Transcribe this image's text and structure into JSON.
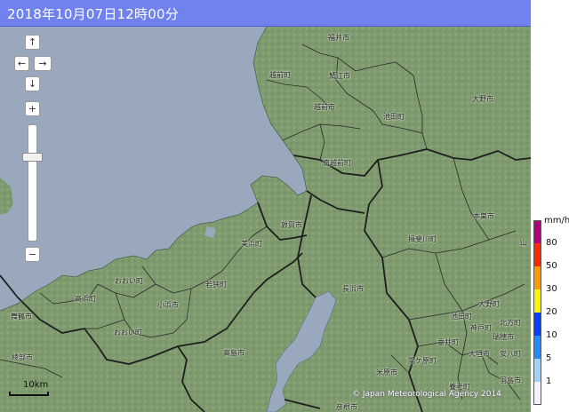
{
  "header": {
    "timestamp": "2018年10月07日12時00分"
  },
  "controls": {
    "up": "↑",
    "left": "←",
    "right": "→",
    "down": "↓",
    "zoom_in": "+",
    "zoom_out": "−",
    "zoom_level": 0.78
  },
  "scale": {
    "label": "10km"
  },
  "copyright": "© Japan Meteorological Agency 2014",
  "legend": {
    "unit": "mm/h",
    "levels": [
      {
        "value": "80",
        "color": "#b4007e"
      },
      {
        "value": "50",
        "color": "#ff2800"
      },
      {
        "value": "30",
        "color": "#ff9900"
      },
      {
        "value": "20",
        "color": "#faf500"
      },
      {
        "value": "10",
        "color": "#0041ff"
      },
      {
        "value": "5",
        "color": "#218cff"
      },
      {
        "value": "1",
        "color": "#a0d2ff"
      },
      {
        "value": "",
        "color": "#f2f2ff"
      }
    ]
  },
  "map": {
    "sea_color": "#9aa8be",
    "land_color": "#7f9a6e",
    "cities": [
      {
        "name": "福井市"
      },
      {
        "name": "越前町"
      },
      {
        "name": "鯖江市"
      },
      {
        "name": "越前市"
      },
      {
        "name": "池田町"
      },
      {
        "name": "大野市"
      },
      {
        "name": "南越前町"
      },
      {
        "name": "敦賀市"
      },
      {
        "name": "美浜町"
      },
      {
        "name": "おおい町"
      },
      {
        "name": "若狭町"
      },
      {
        "name": "高浜町"
      },
      {
        "name": "小浜市"
      },
      {
        "name": "おおい町"
      },
      {
        "name": "舞鶴市"
      },
      {
        "name": "綾部市"
      },
      {
        "name": "高島市"
      },
      {
        "name": "長浜市"
      },
      {
        "name": "揖斐川町"
      },
      {
        "name": "本巣市"
      },
      {
        "name": "山"
      },
      {
        "name": "大野町"
      },
      {
        "name": "池田町"
      },
      {
        "name": "神戸町"
      },
      {
        "name": "北方町"
      },
      {
        "name": "垂井町"
      },
      {
        "name": "瑞穂市"
      },
      {
        "name": "大垣市"
      },
      {
        "name": "安八町"
      },
      {
        "name": "関ケ原町"
      },
      {
        "name": "米原市"
      },
      {
        "name": "彦根市"
      },
      {
        "name": "養老町"
      },
      {
        "name": "羽島市"
      }
    ]
  }
}
